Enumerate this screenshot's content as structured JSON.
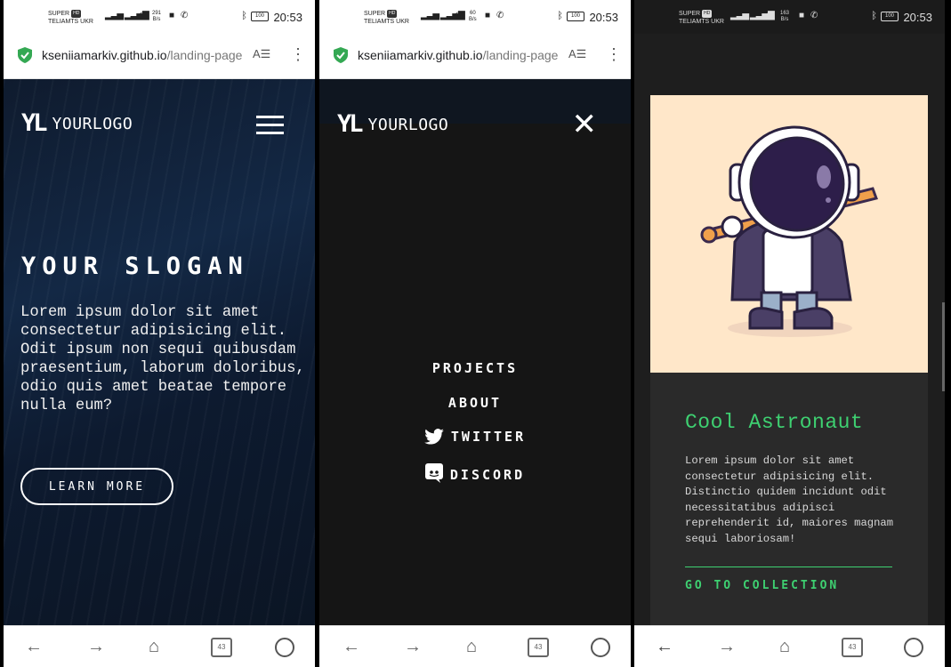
{
  "screens": [
    {
      "status": {
        "carrier_line1": "SUPER",
        "carrier_badge": "HD",
        "carrier_line2": "TELIAMTS UKR",
        "net_rate": "291",
        "net_unit": "B/s",
        "battery": "100",
        "time": "20:53"
      },
      "browser": {
        "url_domain": "kseniiamarkiv.github.io",
        "url_path": "/landing-page"
      },
      "header": {
        "logo_mark": "YL",
        "logo_text": "YOURLOGO"
      },
      "hero": {
        "slogan": "YOUR SLOGAN",
        "text": "Lorem ipsum dolor sit amet consectetur adipisicing elit. Odit ipsum non sequi quibusdam praesentium, laborum doloribus, odio quis amet beatae tempore nulla eum?",
        "cta": "LEARN MORE"
      },
      "tabs_count": "43"
    },
    {
      "status": {
        "carrier_line1": "SUPER",
        "carrier_badge": "HD",
        "carrier_line2": "TELIAMTS UKR",
        "net_rate": "60",
        "net_unit": "B/s",
        "battery": "100",
        "time": "20:53"
      },
      "browser": {
        "url_domain": "kseniiamarkiv.github.io",
        "url_path": "/landing-page"
      },
      "header": {
        "logo_mark": "YL",
        "logo_text": "YOURLOGO"
      },
      "menu": {
        "items": [
          "PROJECTS",
          "ABOUT",
          "TWITTER",
          "DISCORD"
        ]
      },
      "tabs_count": "43"
    },
    {
      "status": {
        "carrier_line1": "SUPER",
        "carrier_badge": "HD",
        "carrier_line2": "TELIAMTS UKR",
        "net_rate": "163",
        "net_unit": "B/s",
        "battery": "100",
        "time": "20:53"
      },
      "card": {
        "title": "Cool Astronaut",
        "text": "Lorem ipsum dolor sit amet consectetur adipisicing elit. Distinctio quidem incidunt odit necessitatibus adipisci reprehenderit id, maiores magnam sequi laboriosam!",
        "link": "GO TO COLLECTION"
      },
      "tabs_count": "43"
    }
  ],
  "colors": {
    "accent_green": "#3ed071",
    "hero_bg": "#132845",
    "menu_bg": "#151515",
    "card_bg": "#2a2a2a",
    "card_image_bg": "#ffe7c9"
  },
  "icons": [
    "shield-check-icon",
    "reader-mode-icon",
    "more-vert-icon",
    "hamburger-menu-icon",
    "close-icon",
    "twitter-icon",
    "discord-icon",
    "back-arrow-icon",
    "forward-arrow-icon",
    "home-icon",
    "tabs-icon",
    "profile-icon"
  ]
}
